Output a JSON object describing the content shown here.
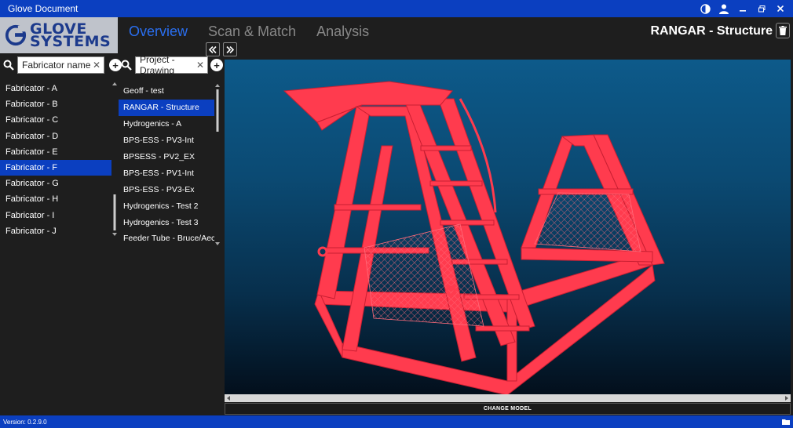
{
  "window": {
    "title": "Glove Document"
  },
  "logo": {
    "line1": "GLOVE",
    "line2": "SYSTEMS"
  },
  "nav": {
    "tabs": [
      {
        "label": "Overview",
        "active": true
      },
      {
        "label": "Scan & Match",
        "active": false
      },
      {
        "label": "Analysis",
        "active": false
      }
    ]
  },
  "page_title": "RANGAR - Structure",
  "fabricator_search": {
    "value": "Fabricator name"
  },
  "project_search": {
    "value": "Project - Drawing"
  },
  "fabricators": [
    "Fabricator - A",
    "Fabricator - B",
    "Fabricator - C",
    "Fabricator - D",
    "Fabricator - E",
    "Fabricator - F",
    "Fabricator - G",
    "Fabricator - H",
    "Fabricator - I",
    "Fabricator - J"
  ],
  "selected_fabricator": "Fabricator - F",
  "projects": [
    "Geoff - test",
    "RANGAR - Structure",
    "Hydrogenics - A",
    "BPS-ESS - PV3-Int",
    "BPSESS - PV2_EX",
    "BPS-ESS - PV1-Int",
    "BPS-ESS - PV3-Ex",
    "Hydrogenics - Test 2",
    "Hydrogenics - Test 3",
    "Feeder Tube - Bruce/Aecon"
  ],
  "selected_project": "RANGAR - Structure",
  "change_model_label": "CHANGE MODEL",
  "version": "Version: 0.2.9.0",
  "colors": {
    "accent": "#0b3fc0",
    "model": "#ff3b4e",
    "tab_active": "#2a6ff0"
  }
}
